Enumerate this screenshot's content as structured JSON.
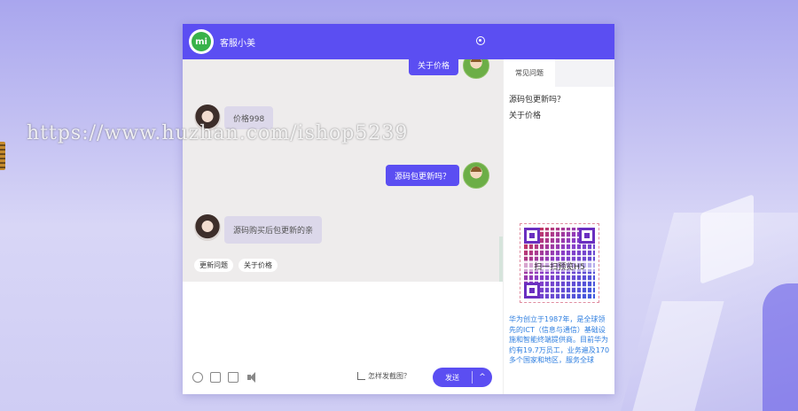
{
  "header": {
    "title": "客服小美",
    "logo_text": "mi",
    "settings_icon": "settings-icon"
  },
  "watermark": "https://www.huzhan.com/ishop5239",
  "messages": [
    {
      "from": "me",
      "text": "关于价格"
    },
    {
      "from": "them",
      "text": "价格998"
    },
    {
      "from": "me",
      "text": "源码包更新吗？"
    },
    {
      "from": "them",
      "text": "源码购买后包更新的亲"
    }
  ],
  "quick_replies": [
    "更新问题",
    "关于价格"
  ],
  "sidebar": {
    "tab": "常见问题",
    "faq": [
      "源码包更新吗？",
      "关于价格"
    ],
    "qr_label": "扫一扫预览H5",
    "description": "华为创立于1987年，是全球领先的ICT（信息与通信）基础设施和智能终端提供商。目前华为约有19.7万员工，业务遍及170多个国家和地区，服务全球"
  },
  "toolbar": {
    "icons": [
      "emoji-icon",
      "image-icon",
      "folder-icon",
      "sound-icon"
    ],
    "screenshot_tip": "怎样发截图？",
    "send_label": "发送",
    "send_arrow": "^"
  }
}
